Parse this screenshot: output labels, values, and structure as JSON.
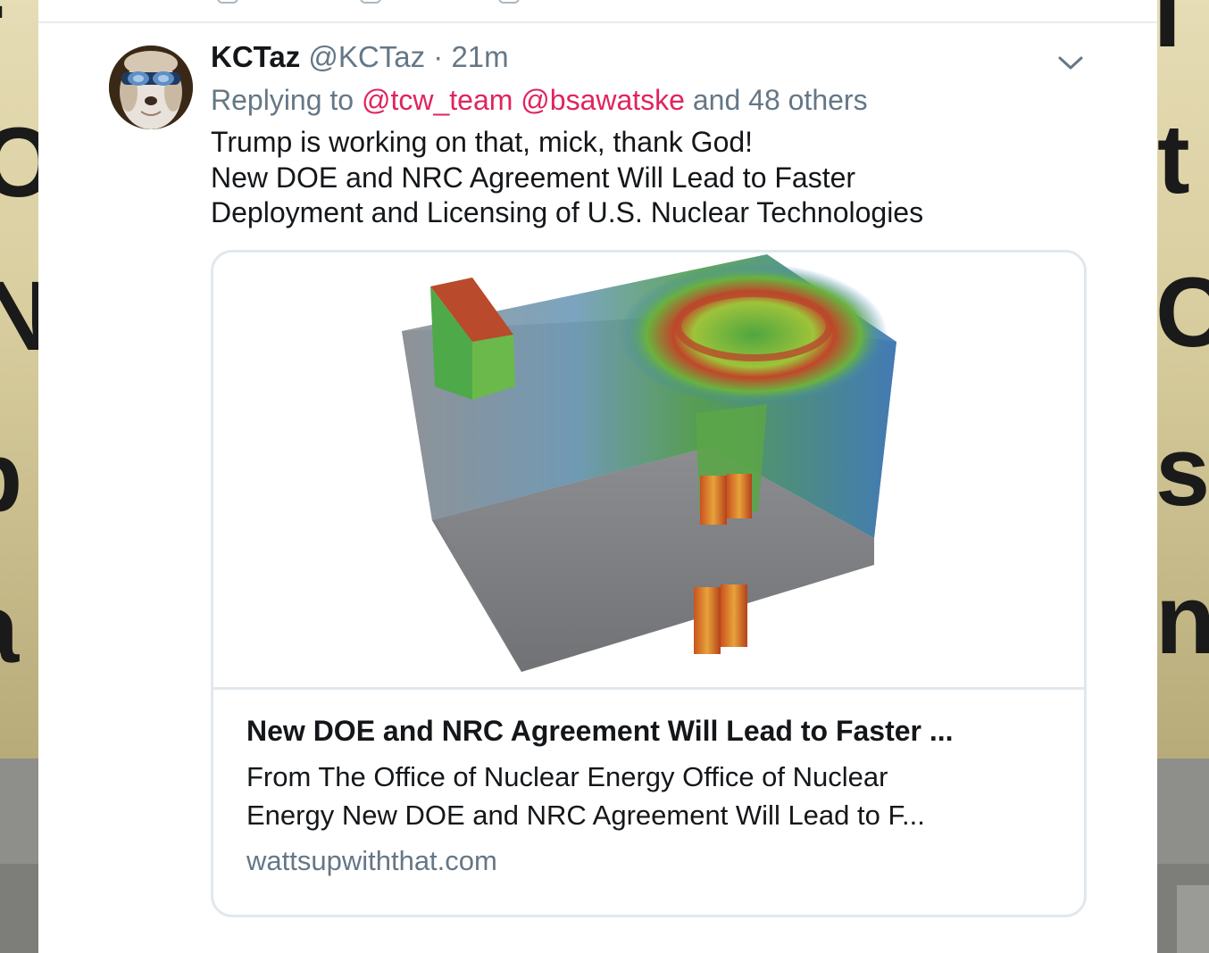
{
  "tweet": {
    "display_name": "KCTaz",
    "handle": "@KCTaz",
    "separator": "·",
    "time": "21m",
    "reply_prefix": "Replying to",
    "reply_mentions": [
      "@tcw_team",
      "@bsawatske"
    ],
    "reply_suffix": "and 48 others",
    "text_lines": [
      "Trump is working on that, mick, thank God!",
      "New DOE and NRC Agreement Will Lead to Faster",
      "Deployment and Licensing of U.S. Nuclear Technologies"
    ],
    "more_icon": "chevron-down-icon"
  },
  "link_card": {
    "title": "New DOE and NRC Agreement Will Lead to Faster ...",
    "description_lines": [
      "From The Office of Nuclear Energy Office of Nuclear",
      "Energy New DOE and NRC Agreement Will Lead to F..."
    ],
    "domain": "wattsupwiththat.com"
  },
  "colors": {
    "mention": "#e0245e",
    "secondary_text": "#657786",
    "primary_text": "#14171a",
    "border": "#e1e8ed"
  }
}
